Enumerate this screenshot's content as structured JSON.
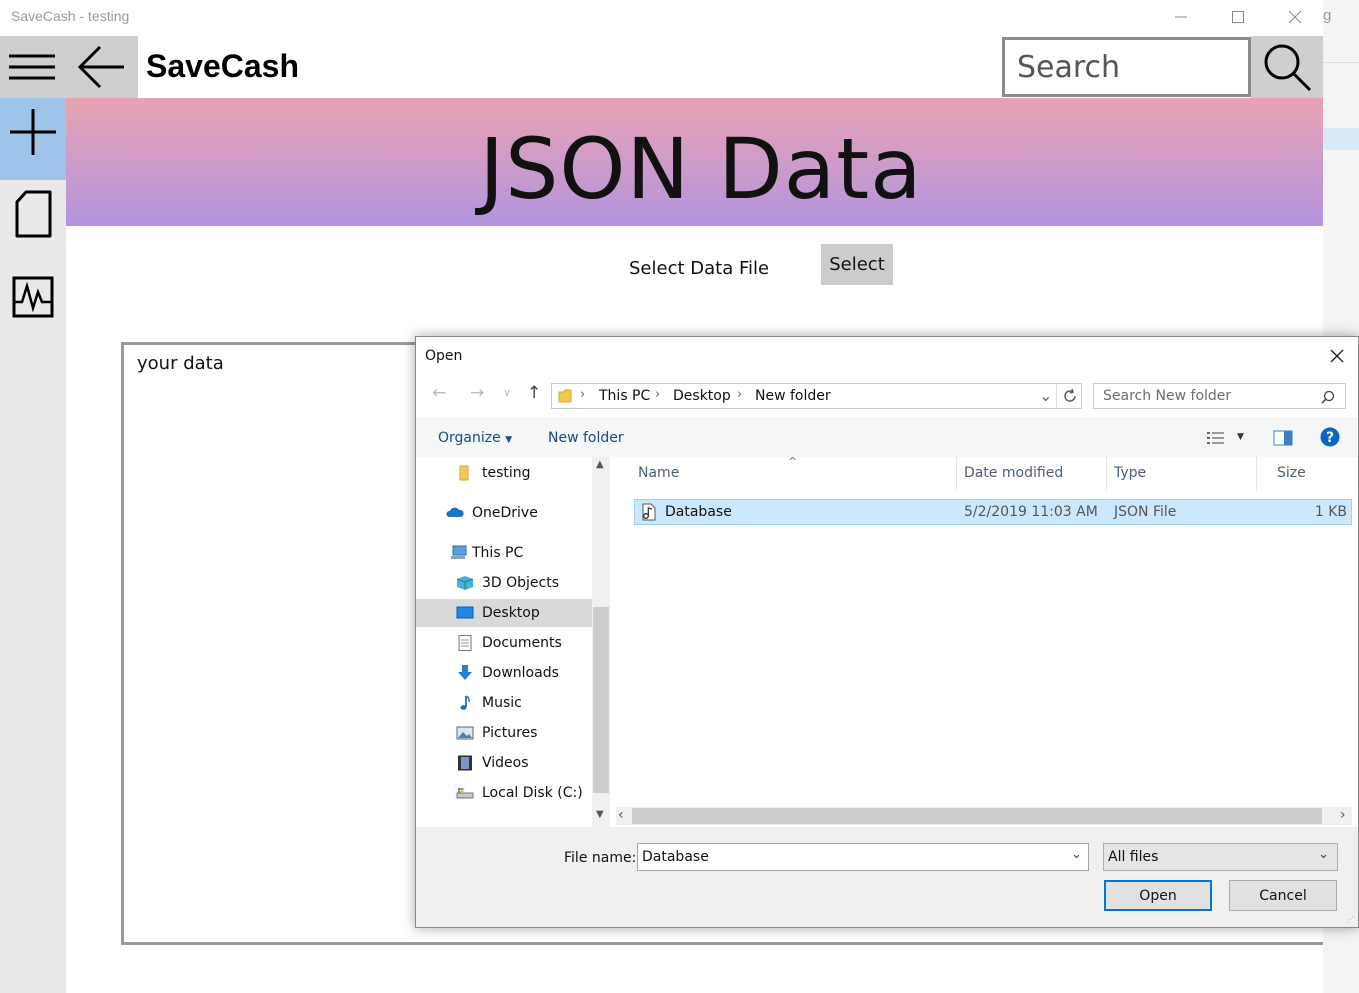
{
  "window": {
    "title": "SaveCash - testing"
  },
  "appbar": {
    "brand": "SaveCash",
    "search_placeholder": "Search"
  },
  "hero": {
    "title": "JSON Data"
  },
  "main": {
    "select_label": "Select Data File",
    "select_button": "Select",
    "data_placeholder": "your data"
  },
  "background_window": {
    "partial_char": "g"
  },
  "dialog": {
    "title": "Open",
    "breadcrumb": [
      "This PC",
      "Desktop",
      "New folder"
    ],
    "search_placeholder": "Search New folder",
    "organize_label": "Organize",
    "new_folder_label": "New folder",
    "nav_items": [
      {
        "label": "testing",
        "icon": "folder-icon"
      },
      {
        "label": "OneDrive",
        "icon": "cloud-icon"
      },
      {
        "label": "This PC",
        "icon": "computer-icon"
      },
      {
        "label": "3D Objects",
        "icon": "cube-icon"
      },
      {
        "label": "Desktop",
        "icon": "desktop-icon",
        "selected": true
      },
      {
        "label": "Documents",
        "icon": "document-icon"
      },
      {
        "label": "Downloads",
        "icon": "download-icon"
      },
      {
        "label": "Music",
        "icon": "music-icon"
      },
      {
        "label": "Pictures",
        "icon": "picture-icon"
      },
      {
        "label": "Videos",
        "icon": "video-icon"
      },
      {
        "label": "Local Disk (C:)",
        "icon": "disk-icon"
      }
    ],
    "columns": {
      "name": "Name",
      "date": "Date modified",
      "type": "Type",
      "size": "Size"
    },
    "files": [
      {
        "name": "Database",
        "date": "5/2/2019 11:03 AM",
        "type": "JSON File",
        "size": "1 KB",
        "selected": true
      }
    ],
    "file_name_label": "File name:",
    "file_name_value": "Database",
    "filter_value": "All files",
    "open_label": "Open",
    "cancel_label": "Cancel",
    "accent": "#0078d7"
  }
}
